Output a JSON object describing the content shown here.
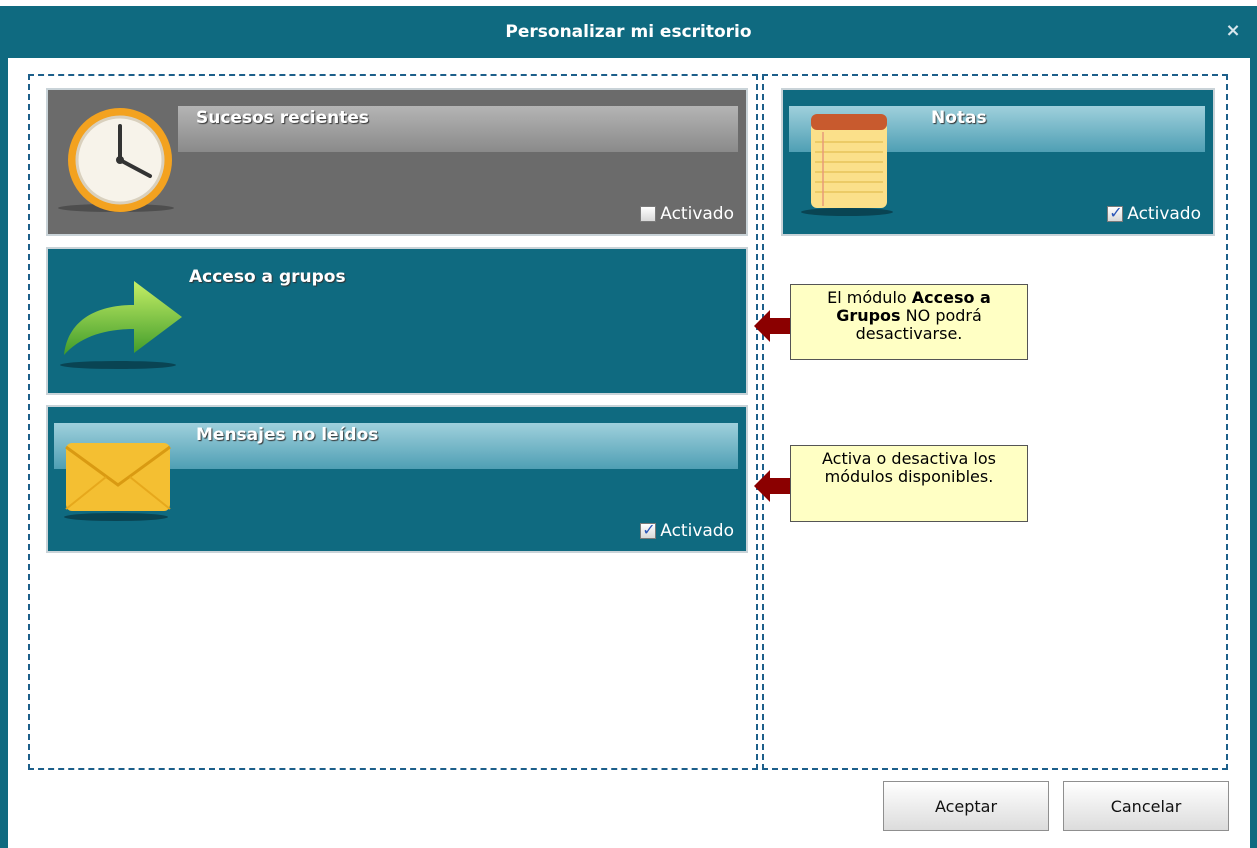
{
  "dialog": {
    "title": "Personalizar mi escritorio",
    "close_glyph": "×"
  },
  "modules": {
    "sucesos": {
      "title": "Sucesos recientes",
      "checkbox_label": "Activado",
      "checked": false,
      "icon": "clock-icon"
    },
    "acceso": {
      "title": "Acceso a grupos",
      "icon": "arrow-icon"
    },
    "mensajes": {
      "title": "Mensajes no leídos",
      "checkbox_label": "Activado",
      "checked": true,
      "icon": "envelope-icon"
    },
    "notas": {
      "title": "Notas",
      "checkbox_label": "Activado",
      "checked": true,
      "icon": "notepad-icon"
    }
  },
  "tooltips": {
    "acceso": {
      "prefix": "El módulo ",
      "bold": "Acceso a Grupos",
      "suffix": " NO podrá desactivarse."
    },
    "activa": {
      "text": "Activa o desactiva los  módulos disponibles."
    }
  },
  "buttons": {
    "ok": "Aceptar",
    "cancel": "Cancelar"
  },
  "colors": {
    "titlebar": "#0f6a80",
    "module_teal": "#0f6a80",
    "module_gray": "#6b6b6b",
    "tooltip": "#ffffc4",
    "callout_arrow": "#8b0000"
  }
}
